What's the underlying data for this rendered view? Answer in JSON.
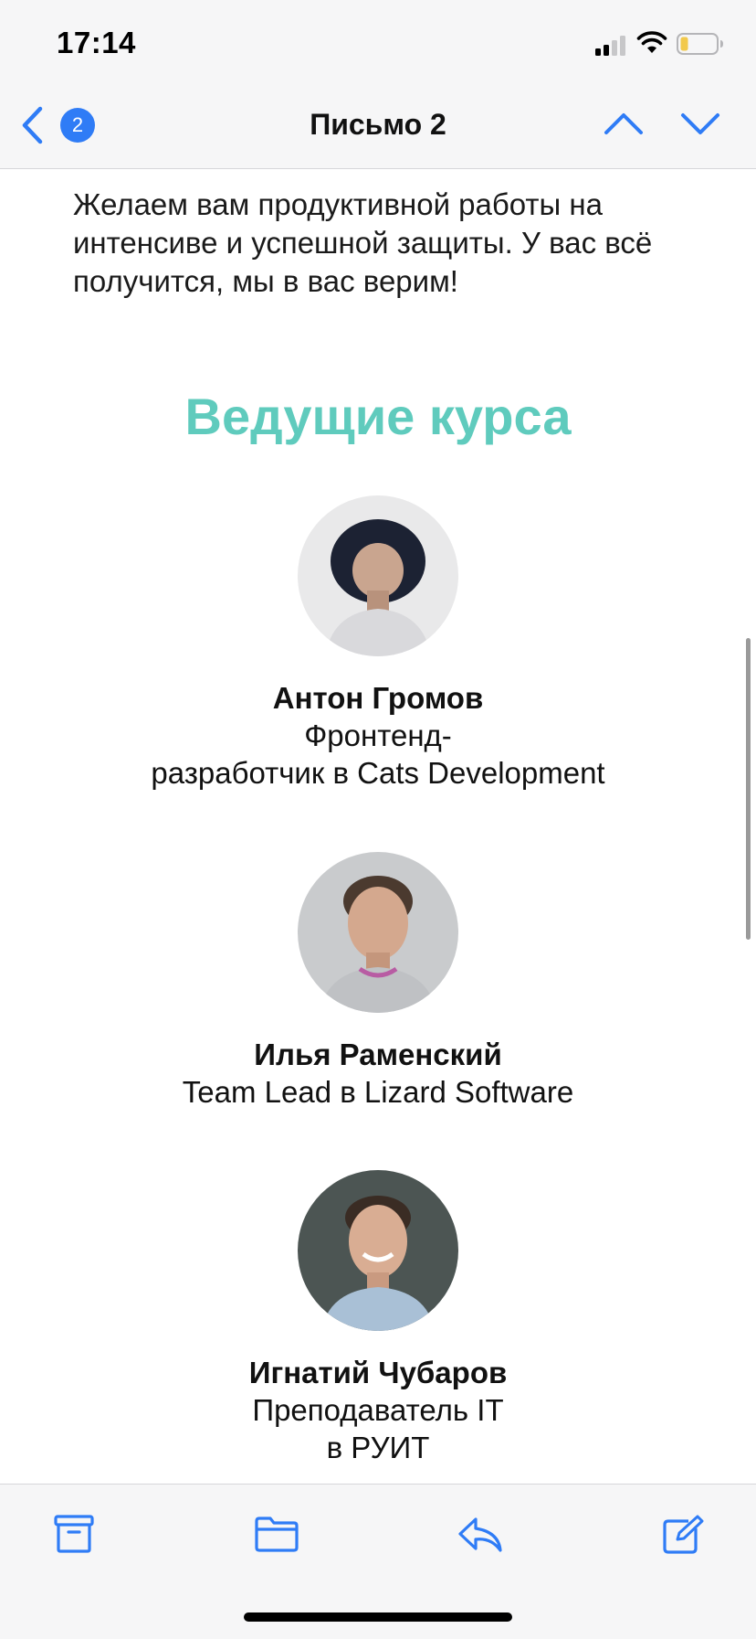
{
  "status": {
    "time": "17:14"
  },
  "nav": {
    "unread_count": "2",
    "title": "Письмо 2"
  },
  "email": {
    "intro_text": "Желаем вам продуктивной работы на интенсиве и успешной защиты. У вас всё получится, мы в вас верим!",
    "section_title": "Ведущие курса",
    "hosts": [
      {
        "name": "Антон Громов",
        "role_line1": "Фронтенд-",
        "role_line2": "разработчик в Cats Development"
      },
      {
        "name": "Илья Раменский",
        "role_line1": "Team Lead в Lizard Software",
        "role_line2": ""
      },
      {
        "name": "Игнатий Чубаров",
        "role_line1": "Преподаватель IT",
        "role_line2": "в РУИТ"
      }
    ]
  },
  "icons": {
    "back": "chevron-left-icon",
    "prev": "chevron-up-icon",
    "next": "chevron-down-icon",
    "archive": "archive-icon",
    "move": "folder-icon",
    "reply": "reply-icon",
    "compose": "compose-icon"
  },
  "colors": {
    "accent": "#2f7cf6",
    "section_title": "#5fcbbd",
    "bar_background": "#f6f6f7"
  }
}
